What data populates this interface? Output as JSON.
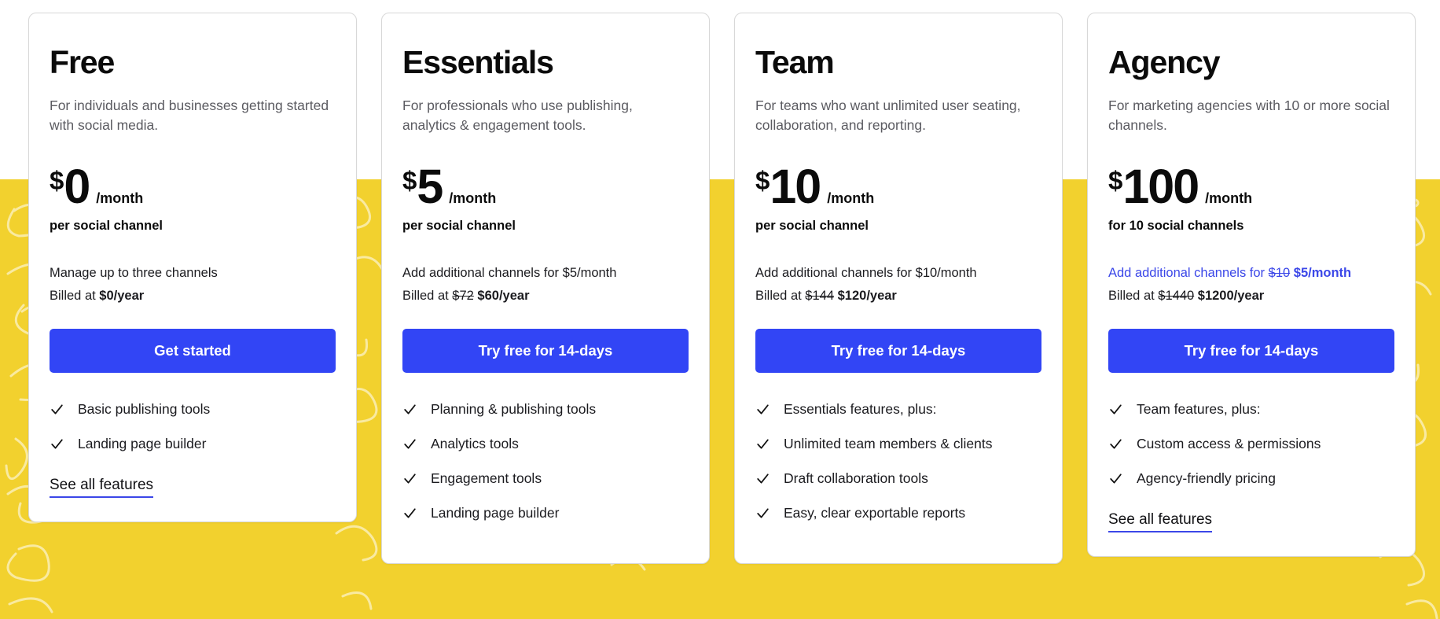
{
  "theme": {
    "accent_blue": "#3245F5",
    "link_blue": "#3b47e8",
    "band_yellow": "#F2D12E",
    "card_bg": "#ffffff",
    "text_dark": "#0b0b0b",
    "text_muted": "#5b5b61"
  },
  "plans": [
    {
      "name": "Free",
      "description": "For individuals and businesses getting started with social media.",
      "currency": "$",
      "amount": "0",
      "period": "/month",
      "price_sub": "per social channel",
      "notes": [
        {
          "is_link": false,
          "parts": [
            {
              "text": "Manage up to three channels",
              "style": "normal"
            }
          ]
        },
        {
          "is_link": false,
          "parts": [
            {
              "text": "Billed at ",
              "style": "normal"
            },
            {
              "text": "$0/year",
              "style": "bold"
            }
          ]
        }
      ],
      "cta_label": "Get started",
      "features": [
        "Basic publishing tools",
        "Landing page builder"
      ],
      "see_all_label": "See all features"
    },
    {
      "name": "Essentials",
      "description": "For professionals who use publishing, analytics & engagement tools.",
      "currency": "$",
      "amount": "5",
      "period": "/month",
      "price_sub": "per social channel",
      "notes": [
        {
          "is_link": false,
          "parts": [
            {
              "text": "Add additional channels for $5/month",
              "style": "normal"
            }
          ]
        },
        {
          "is_link": false,
          "parts": [
            {
              "text": "Billed at ",
              "style": "normal"
            },
            {
              "text": "$72",
              "style": "strike"
            },
            {
              "text": " ",
              "style": "normal"
            },
            {
              "text": "$60/year",
              "style": "bold"
            }
          ]
        }
      ],
      "cta_label": "Try free for 14-days",
      "features": [
        "Planning & publishing tools",
        "Analytics tools",
        "Engagement tools",
        "Landing page builder"
      ],
      "see_all_label": ""
    },
    {
      "name": "Team",
      "description": "For teams who want unlimited user seating, collaboration, and reporting.",
      "currency": "$",
      "amount": "10",
      "period": "/month",
      "price_sub": "per social channel",
      "notes": [
        {
          "is_link": false,
          "parts": [
            {
              "text": "Add additional channels for $10/month",
              "style": "normal"
            }
          ]
        },
        {
          "is_link": false,
          "parts": [
            {
              "text": "Billed at ",
              "style": "normal"
            },
            {
              "text": "$144",
              "style": "strike"
            },
            {
              "text": " ",
              "style": "normal"
            },
            {
              "text": "$120/year",
              "style": "bold"
            }
          ]
        }
      ],
      "cta_label": "Try free for 14-days",
      "features": [
        "Essentials features, plus:",
        "Unlimited team members & clients",
        "Draft collaboration tools",
        "Easy, clear exportable reports"
      ],
      "see_all_label": ""
    },
    {
      "name": "Agency",
      "description": "For marketing agencies with 10 or more social channels.",
      "currency": "$",
      "amount": "100",
      "period": "/month",
      "price_sub": "for 10 social channels",
      "notes": [
        {
          "is_link": true,
          "parts": [
            {
              "text": "Add additional channels for ",
              "style": "normal"
            },
            {
              "text": "$10",
              "style": "strike"
            },
            {
              "text": " ",
              "style": "normal"
            },
            {
              "text": "$5/month",
              "style": "bold"
            }
          ]
        },
        {
          "is_link": false,
          "parts": [
            {
              "text": "Billed at ",
              "style": "normal"
            },
            {
              "text": "$1440",
              "style": "strike"
            },
            {
              "text": " ",
              "style": "normal"
            },
            {
              "text": "$1200/year",
              "style": "bold"
            }
          ]
        }
      ],
      "cta_label": "Try free for 14-days",
      "features": [
        "Team features, plus:",
        "Custom access & permissions",
        "Agency-friendly pricing"
      ],
      "see_all_label": "See all features"
    }
  ],
  "icons": {
    "check": "check-icon"
  }
}
